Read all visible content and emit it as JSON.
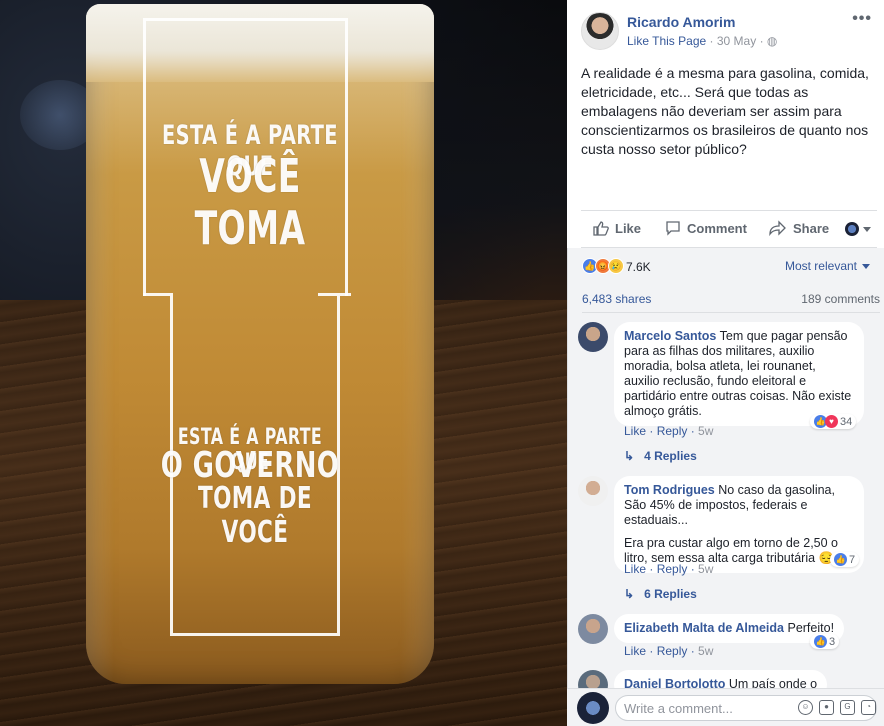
{
  "photo": {
    "glass_text_top_1": "ESTA É A PARTE QUE",
    "glass_text_top_2": "VOCÊ TOMA",
    "glass_text_bottom_1": "ESTA É A PARTE QUE",
    "glass_text_bottom_2": "O GOVERNO",
    "glass_text_bottom_3": "TOMA DE VOCÊ"
  },
  "post": {
    "page_name": "Ricardo Amorim",
    "like_page": "Like This Page",
    "date": "30 May",
    "more": "•••",
    "text": "A realidade é a mesma para gasolina, comida, eletricidade, etc... Será que todas as embalagens não deveriam ser assim para conscientizarmos os brasileiros de quanto nos custa nosso setor público?"
  },
  "actions": {
    "like": "Like",
    "comment": "Comment",
    "share": "Share"
  },
  "stats": {
    "reactions": "7.6K",
    "sort": "Most relevant",
    "shares": "6,483 shares",
    "comments": "189 comments"
  },
  "comments": [
    {
      "author": "Marcelo Santos",
      "text": "Tem que pagar pensão para as filhas dos militares, auxilio moradia, bolsa atleta, lei rounanet, auxilio reclusão, fundo eleitoral e partidário entre outras coisas. Não existe almoço grátis.",
      "like": "Like",
      "reply": "Reply",
      "time": "5w",
      "reactions": "34",
      "replies": "4 Replies"
    },
    {
      "author": "Tom Rodrigues",
      "text": "No caso da gasolina, São 45% de impostos, federais e estaduais...",
      "text2": "Era pra custar algo em torno de 2,50 o litro, sem essa alta carga tributária",
      "emoji": "😔",
      "like": "Like",
      "reply": "Reply",
      "time": "5w",
      "reactions": "7",
      "replies": "6 Replies"
    },
    {
      "author": "Elizabeth Malta de Almeida",
      "text": "Perfeito!",
      "like": "Like",
      "reply": "Reply",
      "time": "5w",
      "reactions": "3"
    },
    {
      "author": "Daniel Bortolotto",
      "text": "Um país onde o"
    }
  ],
  "write": {
    "placeholder": "Write a comment..."
  }
}
